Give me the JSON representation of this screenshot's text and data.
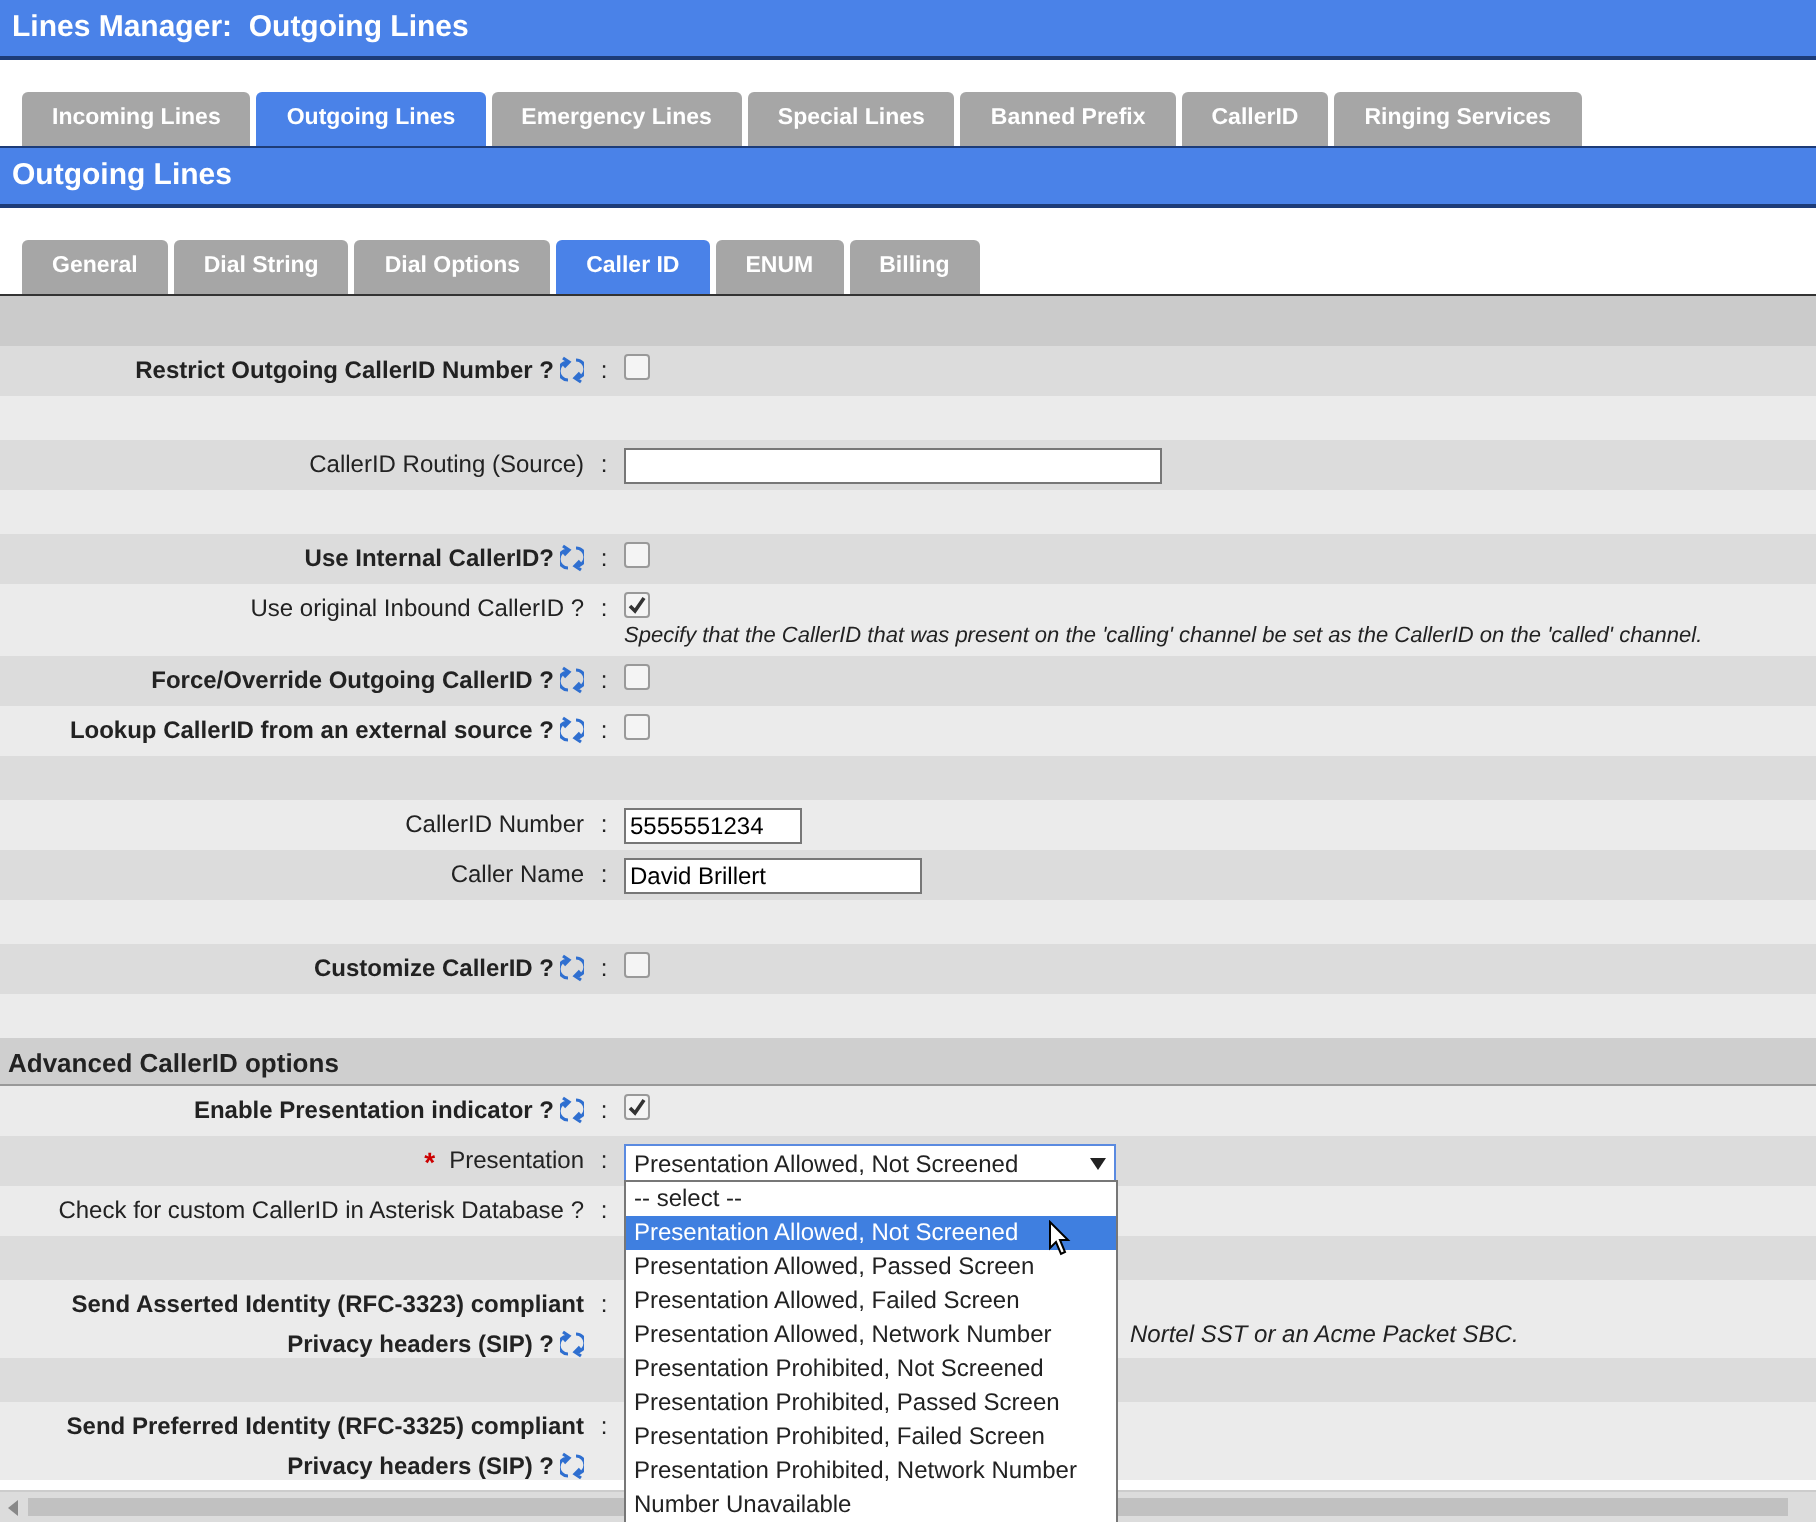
{
  "window": {
    "title": "Lines Manager:  Outgoing Lines"
  },
  "tabs": [
    {
      "label": "Incoming Lines",
      "selected": false
    },
    {
      "label": "Outgoing Lines",
      "selected": true
    },
    {
      "label": "Emergency Lines",
      "selected": false
    },
    {
      "label": "Special Lines",
      "selected": false
    },
    {
      "label": "Banned Prefix",
      "selected": false
    },
    {
      "label": "CallerID",
      "selected": false
    },
    {
      "label": "Ringing Services",
      "selected": false
    }
  ],
  "section_title": "Outgoing Lines",
  "subtabs": [
    {
      "label": "General",
      "selected": false
    },
    {
      "label": "Dial String",
      "selected": false
    },
    {
      "label": "Dial Options",
      "selected": false
    },
    {
      "label": "Caller ID",
      "selected": true
    },
    {
      "label": "ENUM",
      "selected": false
    },
    {
      "label": "Billing",
      "selected": false
    }
  ],
  "rows": [
    {
      "kind": "band"
    },
    {
      "kind": "toggle",
      "label": "Restrict Outgoing CallerID Number ?",
      "separator": ":",
      "checked": false
    },
    {
      "kind": "spacer"
    },
    {
      "kind": "source",
      "label": "CallerID Routing (Source)",
      "separator": ":"
    },
    {
      "kind": "spacer"
    },
    {
      "kind": "toggle",
      "label": "Use Internal CallerID?",
      "separator": ":",
      "checked": false
    },
    {
      "kind": "check",
      "label": "Use original Inbound CallerID ?",
      "separator": ":",
      "checked": true,
      "note": "Specify that the CallerID that was present on the 'calling' channel be set as the CallerID on the 'called' channel."
    },
    {
      "kind": "toggle",
      "label": "Force/Override Outgoing CallerID ?",
      "separator": ":",
      "checked": false
    },
    {
      "kind": "toggle",
      "label": "Lookup CallerID from an external source ?",
      "separator": ":",
      "checked": false
    },
    {
      "kind": "spacer"
    },
    {
      "kind": "number",
      "label": "CallerID Number",
      "separator": ":",
      "value": "5555551234"
    },
    {
      "kind": "name",
      "label": "Caller Name",
      "separator": ":",
      "value": "David Brillert"
    },
    {
      "kind": "spacer"
    },
    {
      "kind": "toggle",
      "label": "Customize CallerID ?",
      "separator": ":",
      "checked": false
    },
    {
      "kind": "spacer"
    },
    {
      "kind": "section",
      "label": "Advanced CallerID options"
    },
    {
      "kind": "toggle",
      "label": "Enable Presentation indicator ?",
      "separator": ":",
      "checked": true
    },
    {
      "kind": "select",
      "label": "Presentation",
      "separator": ":",
      "required_mark": "*",
      "value": "Presentation Allowed, Not Screened",
      "options": [
        {
          "label": "-- select --",
          "selected": false
        },
        {
          "label": "Presentation Allowed, Not Screened",
          "selected": true
        },
        {
          "label": "Presentation Allowed, Passed Screen",
          "selected": false
        },
        {
          "label": "Presentation Allowed, Failed Screen",
          "selected": false
        },
        {
          "label": "Presentation Allowed, Network Number",
          "selected": false
        },
        {
          "label": "Presentation Prohibited, Not Screened",
          "selected": false
        },
        {
          "label": "Presentation Prohibited, Passed Screen",
          "selected": false
        },
        {
          "label": "Presentation Prohibited, Failed Screen",
          "selected": false
        },
        {
          "label": "Presentation Prohibited, Network Number",
          "selected": false
        },
        {
          "label": "Number Unavailable",
          "selected": false
        }
      ]
    },
    {
      "kind": "covered",
      "label_lines": [
        "Check for custom CallerID in Asterisk Database ?"
      ],
      "separator": ":"
    },
    {
      "kind": "spacer"
    },
    {
      "kind": "covered_toggle",
      "label_lines": [
        "Send Asserted Identity (RFC-3323) compliant",
        "Privacy headers (SIP) ?"
      ],
      "separator": ":",
      "note": "Nortel SST or an Acme Packet SBC."
    },
    {
      "kind": "spacer"
    },
    {
      "kind": "covered_toggle",
      "label_lines": [
        "Send Preferred Identity (RFC-3325) compliant",
        "Privacy headers (SIP) ?"
      ],
      "separator": ":"
    }
  ]
}
